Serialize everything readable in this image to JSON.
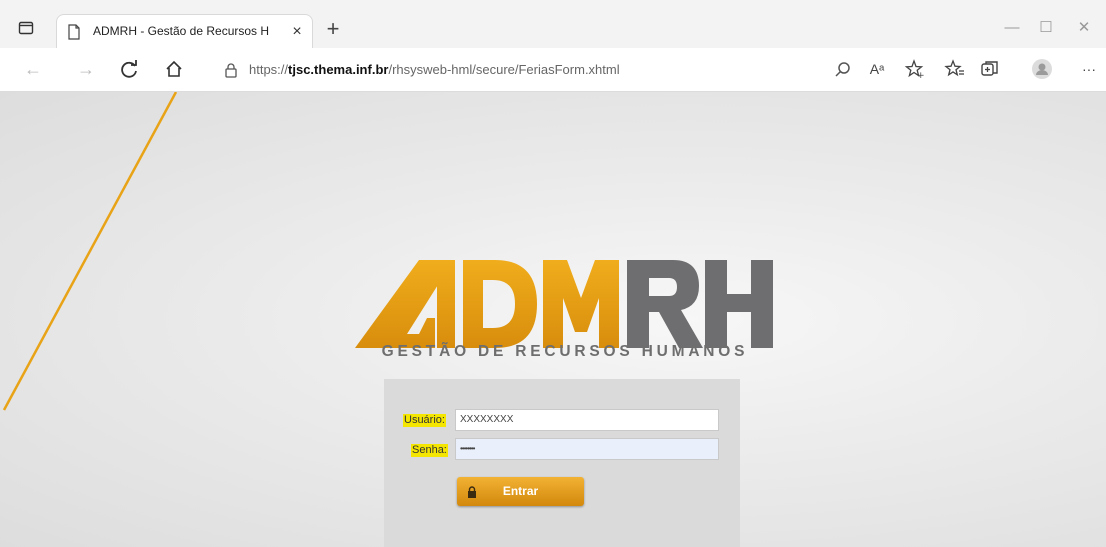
{
  "browser": {
    "tab_title": "ADMRH - Gestão de Recursos H",
    "tab_close": "×",
    "new_tab": "+",
    "url_prefix": "https://",
    "url_host": "tjsc.thema.inf.br",
    "url_path": "/rhsysweb-hml/secure/FeriasForm.xhtml",
    "read_aloud": "Aᵃ",
    "menu": "···",
    "window_minimize": "—",
    "window_maximize": "☐",
    "window_close": "✕",
    "icons": [
      "tab-actions-icon",
      "page-icon",
      "back-icon",
      "forward-icon",
      "refresh-icon",
      "home-icon",
      "info-icon",
      "search-icon",
      "read-aloud-icon",
      "add-favorite-icon",
      "favorites-icon",
      "collections-icon",
      "profile-icon",
      "more-icon"
    ]
  },
  "logo": {
    "wordmark": "ADMRH",
    "tagline": "GESTÃO DE RECURSOS HUMANOS",
    "colors": {
      "orange": "#e59f12",
      "gray": "#6e6e70"
    }
  },
  "login": {
    "user_label": "Usuário:",
    "user_value": "XXXXXXXX",
    "password_label": "Senha:",
    "password_value": "••••••••",
    "submit_label": "Entrar"
  },
  "colors": {
    "accent": "#e59f12",
    "highlight": "#f4e600",
    "diagonal_line": "#e8a317"
  }
}
